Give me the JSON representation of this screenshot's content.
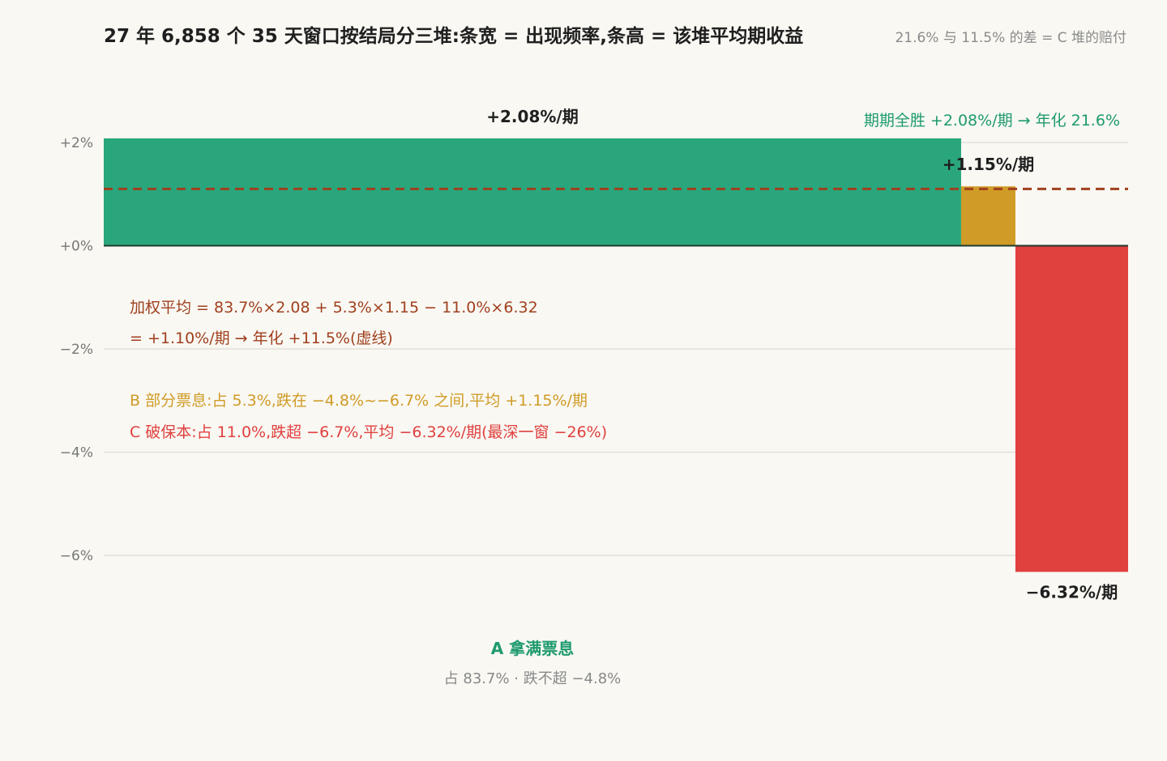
{
  "chart_data": {
    "type": "bar",
    "title": "27 年 6,858 个 35 天窗口按结局分三堆:条宽 = 出现频率,条高 = 该堆平均期收益",
    "subtitle": "21.6% 与 11.5% 的差 = C 堆的赔付",
    "ylim": [
      -7,
      2.5
    ],
    "yticks": [
      {
        "value": 2,
        "label": "+2%"
      },
      {
        "value": 0,
        "label": "+0%"
      },
      {
        "value": -2,
        "label": "−2%"
      },
      {
        "value": -4,
        "label": "−4%"
      },
      {
        "value": -6,
        "label": "−6%"
      }
    ],
    "series": [
      {
        "key": "A",
        "width_pct": 83.7,
        "value": 2.08,
        "label": "+2.08%/期",
        "color": "#2aa67d"
      },
      {
        "key": "B",
        "width_pct": 5.3,
        "value": 1.15,
        "label": "+1.15%/期",
        "color": "#d09b26"
      },
      {
        "key": "C",
        "width_pct": 11.0,
        "value": -6.32,
        "label": "−6.32%/期",
        "color": "#e0403e"
      }
    ],
    "weighted_avg": {
      "value": 1.1,
      "color": "#a0401e",
      "line1": "加权平均 = 83.7%×2.08 + 5.3%×1.15 − 11.0%×6.32",
      "line2": "= +1.10%/期 → 年化 +11.5%(虚线)"
    },
    "top_note": {
      "text": "期期全胜 +2.08%/期 → 年化 21.6%",
      "color": "#1e9a6e"
    },
    "notes": [
      {
        "text": "B 部分票息:占 5.3%,跌在 −4.8%~−6.7% 之间,平均 +1.15%/期",
        "color": "#d09b26"
      },
      {
        "text": "C 破保本:占 11.0%,跌超 −6.7%,平均 −6.32%/期(最深一窗 −26%)",
        "color": "#e0403e"
      }
    ],
    "group_a": {
      "name": "A 拿满票息",
      "detail": "占 83.7% · 跌不超 −4.8%",
      "name_color": "#1e9a6e",
      "detail_color": "#888888"
    }
  }
}
